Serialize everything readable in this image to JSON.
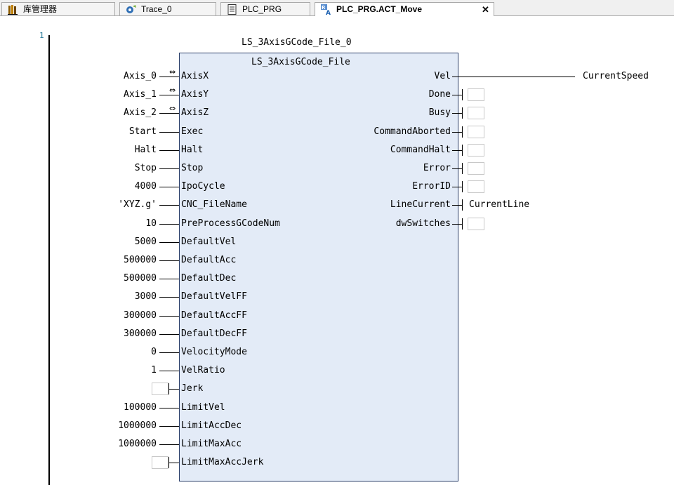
{
  "tabs": [
    {
      "label": "库管理器",
      "icon": "library-books-icon",
      "active": false
    },
    {
      "label": "Trace_0",
      "icon": "trace-icon",
      "active": false
    },
    {
      "label": "PLC_PRG",
      "icon": "document-icon",
      "active": false
    },
    {
      "label": "PLC_PRG.ACT_Move",
      "icon": "action-icon",
      "active": true,
      "close": "✕"
    }
  ],
  "editor": {
    "line_number": "1",
    "instance_name": "LS_3AxisGCode_File_0",
    "block_type": "LS_3AxisGCode_File"
  },
  "inputs": [
    {
      "pin": "AxisX",
      "value": "Axis_0",
      "ref": true
    },
    {
      "pin": "AxisY",
      "value": "Axis_1",
      "ref": true
    },
    {
      "pin": "AxisZ",
      "value": "Axis_2",
      "ref": true
    },
    {
      "pin": "Exec",
      "value": "Start"
    },
    {
      "pin": "Halt",
      "value": "Halt"
    },
    {
      "pin": "Stop",
      "value": "Stop"
    },
    {
      "pin": "IpoCycle",
      "value": "4000"
    },
    {
      "pin": "CNC_FileName",
      "value": "'XYZ.g'"
    },
    {
      "pin": "PreProcessGCodeNum",
      "value": "10"
    },
    {
      "pin": "DefaultVel",
      "value": "5000"
    },
    {
      "pin": "DefaultAcc",
      "value": "500000"
    },
    {
      "pin": "DefaultDec",
      "value": "500000"
    },
    {
      "pin": "DefaultVelFF",
      "value": "3000"
    },
    {
      "pin": "DefaultAccFF",
      "value": "300000"
    },
    {
      "pin": "DefaultDecFF",
      "value": "300000"
    },
    {
      "pin": "VelocityMode",
      "value": "0"
    },
    {
      "pin": "VelRatio",
      "value": "1"
    },
    {
      "pin": "Jerk",
      "value": ""
    },
    {
      "pin": "LimitVel",
      "value": "100000"
    },
    {
      "pin": "LimitAccDec",
      "value": "1000000"
    },
    {
      "pin": "LimitMaxAcc",
      "value": "1000000"
    },
    {
      "pin": "LimitMaxAccJerk",
      "value": ""
    }
  ],
  "outputs": [
    {
      "pin": "Vel",
      "value": "CurrentSpeed"
    },
    {
      "pin": "Done",
      "value": ""
    },
    {
      "pin": "Busy",
      "value": ""
    },
    {
      "pin": "CommandAborted",
      "value": ""
    },
    {
      "pin": "CommandHalt",
      "value": ""
    },
    {
      "pin": "Error",
      "value": ""
    },
    {
      "pin": "ErrorID",
      "value": ""
    },
    {
      "pin": "LineCurrent",
      "value": "CurrentLine"
    },
    {
      "pin": "dwSwitches",
      "value": ""
    }
  ],
  "ref_symbol": "⇔",
  "colors": {
    "block_fill": "#e3ebf7",
    "block_border": "#2b3f6a",
    "tab_bar": "#f0f0f0"
  }
}
